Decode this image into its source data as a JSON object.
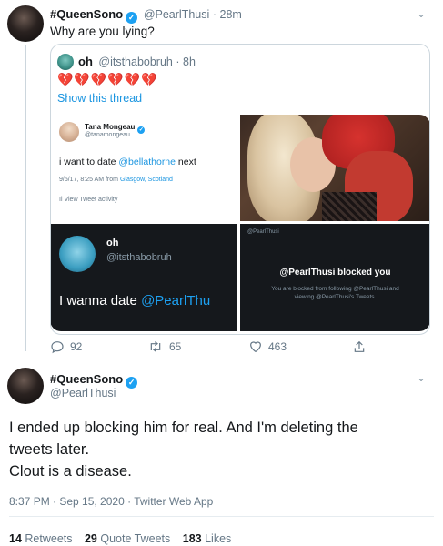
{
  "reply": {
    "display_name": "#QueenSono",
    "handle": "@PearlThusi",
    "time": "· 28m",
    "text": "Why are you lying?"
  },
  "quoted": {
    "display_name": "oh",
    "handle": "@itsthabobruh",
    "time": "· 8h",
    "emoji": "💔💔💔💔💔💔",
    "show_thread": "Show this thread"
  },
  "media": {
    "tl": {
      "name": "Tana Mongeau",
      "handle": "@tanamongeau",
      "text_prefix": "i want to date ",
      "mention": "@bellathorne",
      "text_suffix": " next",
      "meta_prefix": "9/5/17, 8:25 AM from ",
      "meta_place": "Glasgow, Scotland",
      "activity": "View Tweet activity"
    },
    "bl": {
      "name": "oh",
      "handle": "@itsthabobruh",
      "text_prefix": "I wanna date ",
      "mention": "@PearlThu"
    },
    "br": {
      "top_handle": "@PearlThusi",
      "blocked_title": "@PearlThusi blocked you",
      "blocked_line1": "You are blocked from following @PearlThusi and",
      "blocked_line2": "viewing @PearlThusi's Tweets."
    }
  },
  "actions": {
    "replies": "92",
    "retweets": "65",
    "likes": "463"
  },
  "main": {
    "display_name": "#QueenSono",
    "handle": "@PearlThusi",
    "text_line1": "I ended up blocking him for real. And I'm deleting the",
    "text_line2": "tweets later.",
    "text_line3": "Clout is a disease.",
    "timestamp": "8:37 PM · Sep 15, 2020 · Twitter Web App"
  },
  "stats": {
    "retweets_num": "14",
    "retweets_label": "Retweets",
    "quotes_num": "29",
    "quotes_label": "Quote Tweets",
    "likes_num": "183",
    "likes_label": "Likes"
  },
  "colors": {
    "accent": "#1da1f2",
    "link": "#1b95e0",
    "muted": "#657786",
    "dark_card": "#15181c"
  }
}
